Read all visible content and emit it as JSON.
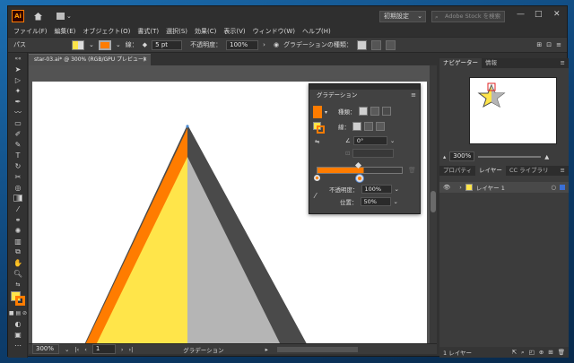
{
  "app": {
    "logo_text": "Ai",
    "workspace_preset": "初期設定",
    "stock_search_placeholder": "Adobe Stock を検索",
    "window_controls": [
      "—",
      "□",
      "✕"
    ]
  },
  "menu": [
    "ファイル(F)",
    "編集(E)",
    "オブジェクト(O)",
    "書式(T)",
    "選択(S)",
    "効果(C)",
    "表示(V)",
    "ウィンドウ(W)",
    "ヘルプ(H)"
  ],
  "control_bar": {
    "object_type": "パス",
    "stroke_label": "線：",
    "stroke_weight": "5 pt",
    "opacity_label": "不透明度：",
    "opacity_value": "100%",
    "gradient_type_label": "グラデーションの種類："
  },
  "document": {
    "tab_title": "star-03.ai* @ 300% (RGB/GPU プレビュー)",
    "zoom": "300%",
    "artboard_number": "1",
    "status_text": "グラデーション",
    "colors": {
      "stroke": "#4a4a4a",
      "orange": "#ff7c00",
      "yellow": "#ffe54a",
      "gray": "#b5b5b5"
    }
  },
  "gradient_panel": {
    "tab_label": "グラデーション",
    "type_label": "種類：",
    "stroke_label": "線：",
    "angle_value": "0°",
    "opacity_label": "不透明度：",
    "opacity_value": "100%",
    "location_label": "位置：",
    "location_value": "50%",
    "stop_colors": [
      "#ff7c00",
      "#ff7c00"
    ]
  },
  "right_panel": {
    "top_tabs": [
      "ナビゲーター",
      "情報"
    ],
    "navigator_zoom": "300%",
    "bottom_tabs": [
      "プロパティ",
      "レイヤー",
      "CC ライブラリ"
    ],
    "layer_name": "レイヤー 1",
    "layer_count": "1 レイヤー"
  }
}
